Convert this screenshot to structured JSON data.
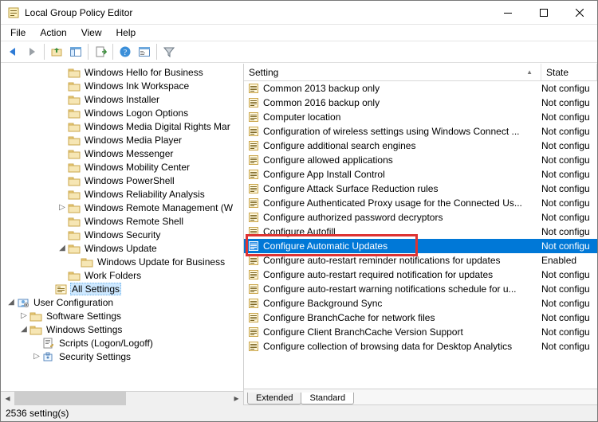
{
  "window": {
    "title": "Local Group Policy Editor"
  },
  "menu": {
    "file": "File",
    "action": "Action",
    "view": "View",
    "help": "Help"
  },
  "tree": {
    "items": [
      {
        "indent": 5,
        "exp": "",
        "icon": "folder",
        "label": "Windows Hello for Business"
      },
      {
        "indent": 5,
        "exp": "",
        "icon": "folder",
        "label": "Windows Ink Workspace"
      },
      {
        "indent": 5,
        "exp": "",
        "icon": "folder",
        "label": "Windows Installer"
      },
      {
        "indent": 5,
        "exp": "",
        "icon": "folder",
        "label": "Windows Logon Options"
      },
      {
        "indent": 5,
        "exp": "",
        "icon": "folder",
        "label": "Windows Media Digital Rights Mar"
      },
      {
        "indent": 5,
        "exp": "",
        "icon": "folder",
        "label": "Windows Media Player"
      },
      {
        "indent": 5,
        "exp": "",
        "icon": "folder",
        "label": "Windows Messenger"
      },
      {
        "indent": 5,
        "exp": "",
        "icon": "folder",
        "label": "Windows Mobility Center"
      },
      {
        "indent": 5,
        "exp": "",
        "icon": "folder",
        "label": "Windows PowerShell"
      },
      {
        "indent": 5,
        "exp": "",
        "icon": "folder",
        "label": "Windows Reliability Analysis"
      },
      {
        "indent": 5,
        "exp": ">",
        "icon": "folder",
        "label": "Windows Remote Management (W"
      },
      {
        "indent": 5,
        "exp": "",
        "icon": "folder",
        "label": "Windows Remote Shell"
      },
      {
        "indent": 5,
        "exp": "",
        "icon": "folder",
        "label": "Windows Security"
      },
      {
        "indent": 5,
        "exp": "v",
        "icon": "folder",
        "label": "Windows Update"
      },
      {
        "indent": 6,
        "exp": "",
        "icon": "folder",
        "label": "Windows Update for Business"
      },
      {
        "indent": 5,
        "exp": "",
        "icon": "folder",
        "label": "Work Folders"
      },
      {
        "indent": 4,
        "exp": "",
        "icon": "allsettings",
        "label": "All Settings",
        "selected": true
      },
      {
        "indent": 1,
        "exp": "v",
        "icon": "userconfig",
        "label": "User Configuration"
      },
      {
        "indent": 2,
        "exp": ">",
        "icon": "folder",
        "label": "Software Settings"
      },
      {
        "indent": 2,
        "exp": "v",
        "icon": "folder",
        "label": "Windows Settings"
      },
      {
        "indent": 3,
        "exp": "",
        "icon": "script",
        "label": "Scripts (Logon/Logoff)"
      },
      {
        "indent": 3,
        "exp": ">",
        "icon": "security",
        "label": "Security Settings"
      }
    ]
  },
  "list": {
    "columns": {
      "setting": "Setting",
      "state": "State"
    },
    "rows": [
      {
        "setting": "Common 2013 backup only",
        "state": "Not configu"
      },
      {
        "setting": "Common 2016 backup only",
        "state": "Not configu"
      },
      {
        "setting": "Computer location",
        "state": "Not configu"
      },
      {
        "setting": "Configuration of wireless settings using Windows Connect ...",
        "state": "Not configu"
      },
      {
        "setting": "Configure additional search engines",
        "state": "Not configu"
      },
      {
        "setting": "Configure allowed applications",
        "state": "Not configu"
      },
      {
        "setting": "Configure App Install Control",
        "state": "Not configu"
      },
      {
        "setting": "Configure Attack Surface Reduction rules",
        "state": "Not configu"
      },
      {
        "setting": "Configure Authenticated Proxy usage for the Connected Us...",
        "state": "Not configu"
      },
      {
        "setting": "Configure authorized password decryptors",
        "state": "Not configu"
      },
      {
        "setting": "Configure Autofill",
        "state": "Not configu"
      },
      {
        "setting": "Configure Automatic Updates",
        "state": "Not configu",
        "selected": true
      },
      {
        "setting": "Configure auto-restart reminder notifications for updates",
        "state": "Enabled"
      },
      {
        "setting": "Configure auto-restart required notification for updates",
        "state": "Not configu"
      },
      {
        "setting": "Configure auto-restart warning notifications schedule for u...",
        "state": "Not configu"
      },
      {
        "setting": "Configure Background Sync",
        "state": "Not configu"
      },
      {
        "setting": "Configure BranchCache for network files",
        "state": "Not configu"
      },
      {
        "setting": "Configure Client BranchCache Version Support",
        "state": "Not configu"
      },
      {
        "setting": "Configure collection of browsing data for Desktop Analytics",
        "state": "Not configu"
      }
    ]
  },
  "tabs": {
    "extended": "Extended",
    "standard": "Standard"
  },
  "status": {
    "text": "2536 setting(s)"
  }
}
